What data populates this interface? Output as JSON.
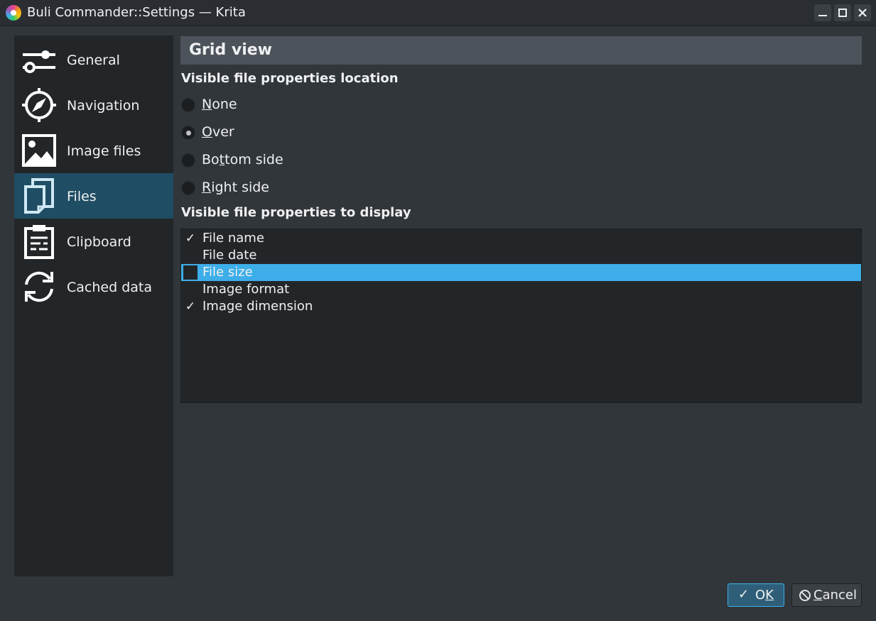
{
  "window": {
    "title": "Buli Commander::Settings — Krita",
    "buttons": {
      "minimize_icon": "minimize-icon",
      "maximize_icon": "maximize-icon",
      "close_icon": "close-icon"
    }
  },
  "sidebar": {
    "items": [
      {
        "label": "General",
        "icon": "sliders-icon",
        "selected": false
      },
      {
        "label": "Navigation",
        "icon": "compass-icon",
        "selected": false
      },
      {
        "label": "Image files",
        "icon": "image-icon",
        "selected": false
      },
      {
        "label": "Files",
        "icon": "files-icon",
        "selected": true
      },
      {
        "label": "Clipboard",
        "icon": "clipboard-icon",
        "selected": false
      },
      {
        "label": "Cached data",
        "icon": "refresh-icon",
        "selected": false
      }
    ]
  },
  "main": {
    "section_title": "Grid view",
    "location_group": {
      "label": "Visible file properties location",
      "options": [
        {
          "pre": "",
          "accel": "N",
          "post": "one",
          "checked": false
        },
        {
          "pre": "",
          "accel": "O",
          "post": "ver",
          "checked": true
        },
        {
          "pre": "Bo",
          "accel": "t",
          "post": "tom side",
          "checked": false
        },
        {
          "pre": "",
          "accel": "R",
          "post": "ight side",
          "checked": false
        }
      ]
    },
    "display_group": {
      "label": "Visible file properties to display",
      "items": [
        {
          "label": "File name",
          "checked": true,
          "selected": false
        },
        {
          "label": "File date",
          "checked": false,
          "selected": false
        },
        {
          "label": "File size",
          "checked": false,
          "selected": true
        },
        {
          "label": "Image format",
          "checked": false,
          "selected": false
        },
        {
          "label": "Image dimension",
          "checked": true,
          "selected": false
        }
      ]
    }
  },
  "footer": {
    "ok": {
      "icon": "checkmark-icon",
      "pre": "O",
      "accel": "K",
      "post": ""
    },
    "cancel": {
      "icon": "cancel-icon",
      "pre": "",
      "accel": "C",
      "post": "ancel"
    }
  },
  "colors": {
    "accent": "#3daee9",
    "selection_sidebar": "#1f4d63",
    "background": "#31363b",
    "panel": "#232629"
  }
}
